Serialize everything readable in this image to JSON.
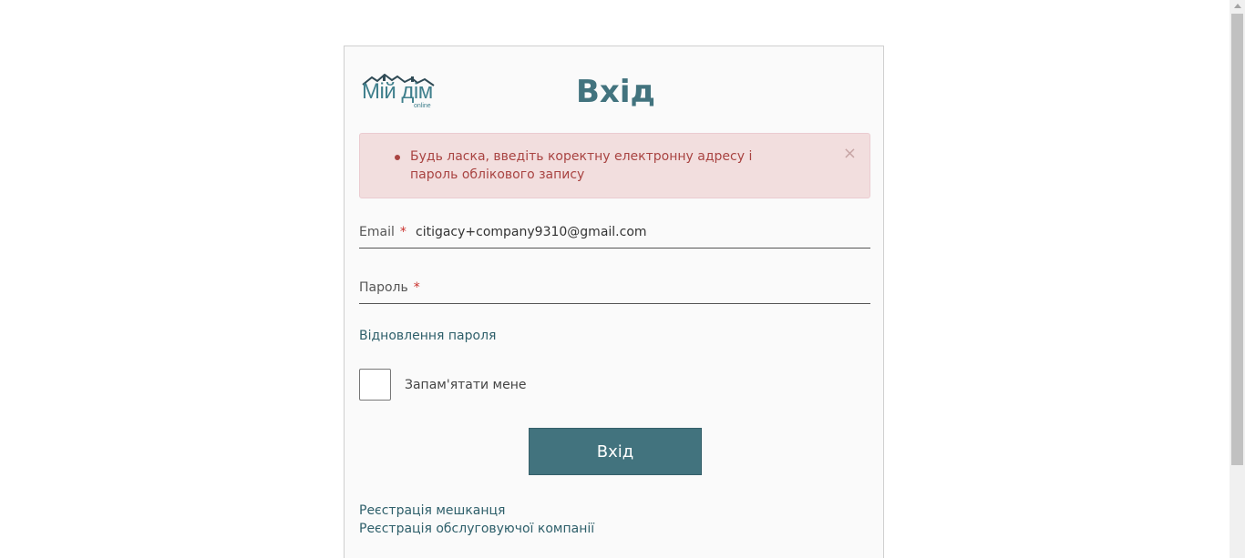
{
  "app": {
    "logo_text": "Мій дім",
    "logo_sub": "online"
  },
  "login": {
    "title": "Вхід",
    "alert": {
      "message": "Будь ласка, введіть коректну електронну адресу і пароль облікового запису",
      "close_glyph": "×"
    },
    "email": {
      "label": "Email",
      "required_mark": "*",
      "value": "citigacy+company9310@gmail.com"
    },
    "password": {
      "label": "Пароль",
      "required_mark": "*",
      "value": ""
    },
    "forgot_password_link": "Відновлення пароля",
    "remember_me": {
      "label": "Запам'ятати мене",
      "checked": false
    },
    "submit_label": "Вхід",
    "register_resident_link": "Реєстрація мешканця",
    "register_company_link": "Реєстрація обслуговуючої компанії"
  },
  "colors": {
    "accent": "#42737e",
    "link": "#2e5f6a",
    "alert_bg": "#f2dede",
    "alert_text": "#a94442",
    "required": "#c9302c"
  },
  "icons": {
    "logo": "house-roof-logo-icon",
    "alert_close": "close-icon"
  }
}
